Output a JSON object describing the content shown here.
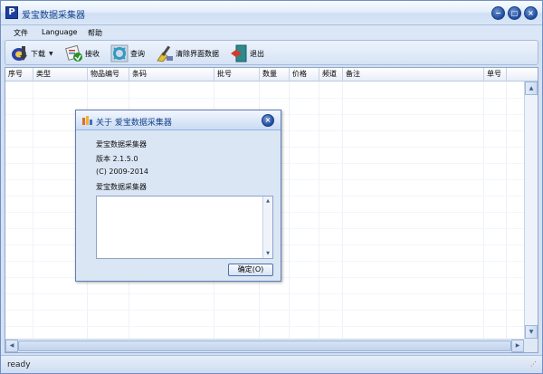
{
  "window": {
    "title": "爱宝数据采集器",
    "app_icon_letter": "P"
  },
  "window_controls": {
    "minimize": "−",
    "restore": "□",
    "close": "×"
  },
  "menu": {
    "items": [
      "文件",
      "Language",
      "帮助"
    ]
  },
  "toolbar": {
    "download": "下载",
    "receive": "接收",
    "query": "查询",
    "clear": "清除界面数据",
    "exit": "退出"
  },
  "grid": {
    "columns": [
      "序号",
      "类型",
      "物品编号",
      "条码",
      "批号",
      "数量",
      "价格",
      "频道",
      "备注",
      "单号"
    ],
    "rows": []
  },
  "scrollbar": {
    "up": "▲",
    "down": "▼",
    "left": "◀",
    "right": "▶"
  },
  "status": {
    "text": "ready"
  },
  "dialog": {
    "title": "关于 爱宝数据采集器",
    "product": "爱宝数据采集器",
    "version": "版本 2.1.5.0",
    "copyright": "(C) 2009-2014",
    "company": "爱宝数据采集器",
    "ok_label": "确定(O)",
    "close_symbol": "×",
    "text_area_value": ""
  },
  "colors": {
    "accent": "#15428b",
    "frame": "#6f8fc3",
    "grid_bg": "#ffffff"
  }
}
